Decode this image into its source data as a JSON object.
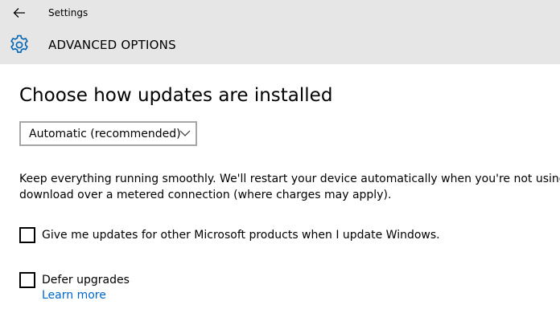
{
  "window": {
    "title": "Settings",
    "back_icon": "arrow-left-icon"
  },
  "header": {
    "icon": "gear-icon",
    "title": "ADVANCED OPTIONS",
    "accent_color": "#0063b1",
    "background_color": "#e6e6e6"
  },
  "main": {
    "section_title": "Choose how updates are installed",
    "install_mode": {
      "selected": "Automatic (recommended)",
      "icon": "chevron-down-icon"
    },
    "description_lines": [
      "Keep everything running smoothly. We'll restart your device automatically when you're not using it. Up",
      "download over a metered connection (where charges may apply)."
    ],
    "options": [
      {
        "label": "Give me updates for other Microsoft products when I update Windows.",
        "checked": false
      },
      {
        "label": "Defer upgrades",
        "checked": false
      }
    ],
    "learn_more": "Learn more",
    "link_color": "#0066cc"
  }
}
